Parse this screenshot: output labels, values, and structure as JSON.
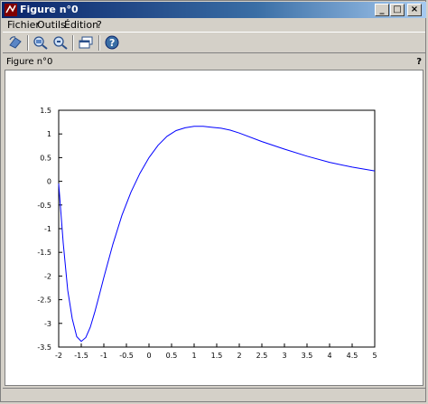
{
  "window": {
    "title": "Figure n°0"
  },
  "menu": {
    "items": [
      "Fichier",
      "Outils",
      "Édition",
      "?"
    ]
  },
  "toolbar": {
    "tools": [
      "rotate-icon",
      "zoom-in-icon",
      "zoom-out-icon",
      "new-window-icon",
      "help-icon"
    ]
  },
  "figure": {
    "label": "Figure n°0",
    "help": "?"
  },
  "chart_data": {
    "type": "line",
    "title": "",
    "xlabel": "",
    "ylabel": "",
    "xlim": [
      -2,
      5
    ],
    "ylim": [
      -3.5,
      1.5
    ],
    "xticks": [
      "-2",
      "-1.5",
      "-1",
      "-0.5",
      "0",
      "0.5",
      "1",
      "1.5",
      "2",
      "2.5",
      "3",
      "3.5",
      "4",
      "4.5",
      "5"
    ],
    "yticks": [
      "-3.5",
      "-3",
      "-2.5",
      "-2",
      "-1.5",
      "-1",
      "-0.5",
      "0",
      "0.5",
      "1",
      "1.5"
    ],
    "grid": false,
    "series": [
      {
        "color": "#0000ff",
        "x": [
          -2,
          -1.9,
          -1.8,
          -1.7,
          -1.6,
          -1.5,
          -1.4,
          -1.3,
          -1.2,
          -1.1,
          -1,
          -0.8,
          -0.6,
          -0.4,
          -0.2,
          0,
          0.2,
          0.4,
          0.6,
          0.8,
          1,
          1.2,
          1.4,
          1.6,
          1.8,
          2,
          2.5,
          3,
          3.5,
          4,
          4.5,
          5
        ],
        "y": [
          -0.05,
          -1.3,
          -2.3,
          -2.9,
          -3.28,
          -3.38,
          -3.3,
          -3.08,
          -2.76,
          -2.4,
          -2.03,
          -1.33,
          -0.72,
          -0.23,
          0.17,
          0.5,
          0.76,
          0.95,
          1.07,
          1.13,
          1.16,
          1.16,
          1.14,
          1.12,
          1.08,
          1.02,
          0.84,
          0.68,
          0.53,
          0.4,
          0.3,
          0.22
        ]
      }
    ]
  },
  "colors": {
    "titlebar": "#0a246a",
    "line": "#0000ff",
    "chrome": "#d4d0c8"
  }
}
